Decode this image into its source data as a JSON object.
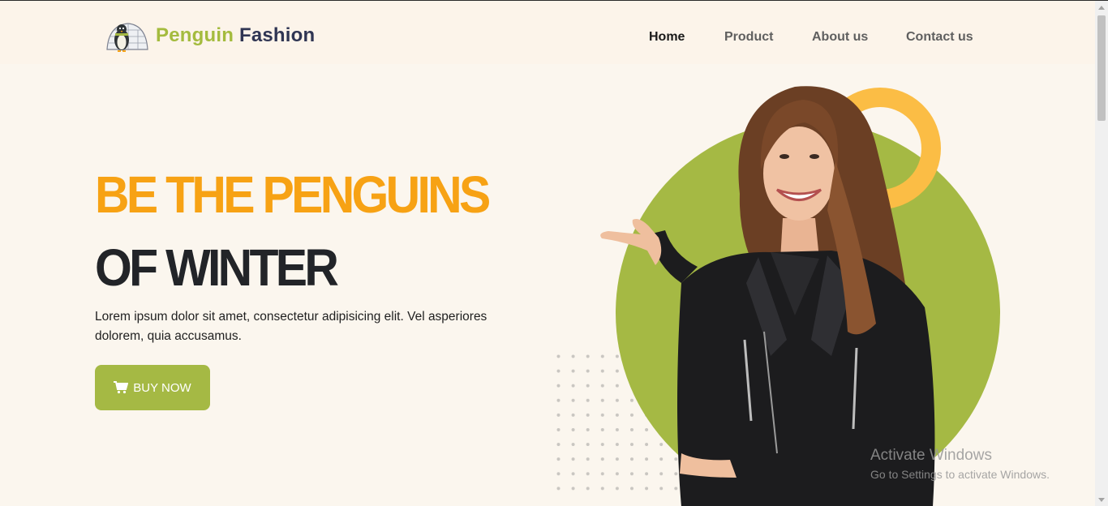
{
  "brand": {
    "name_part1": "Penguin",
    "name_part2": "Fashion",
    "logo_icon": "penguin-igloo-icon"
  },
  "nav": {
    "items": [
      {
        "label": "Home",
        "active": true
      },
      {
        "label": "Product",
        "active": false
      },
      {
        "label": "About us",
        "active": false
      },
      {
        "label": "Contact us",
        "active": false
      }
    ]
  },
  "hero": {
    "title_line1": "BE THE PENGUINS",
    "title_line2": "OF WINTER",
    "description": "Lorem ipsum dolor sit amet, consectetur adipisicing elit. Vel asperiores dolorem, quia accusamus.",
    "button_label": "BUY NOW",
    "button_icon": "shopping-cart-icon"
  },
  "watermark": {
    "title": "Activate Windows",
    "subtitle": "Go to Settings to activate Windows."
  },
  "colors": {
    "accent_green": "#a5b944",
    "accent_orange": "#f7a214",
    "ring_yellow": "#fbbd45",
    "dark_text": "#222428",
    "background": "#fbf6ee"
  }
}
